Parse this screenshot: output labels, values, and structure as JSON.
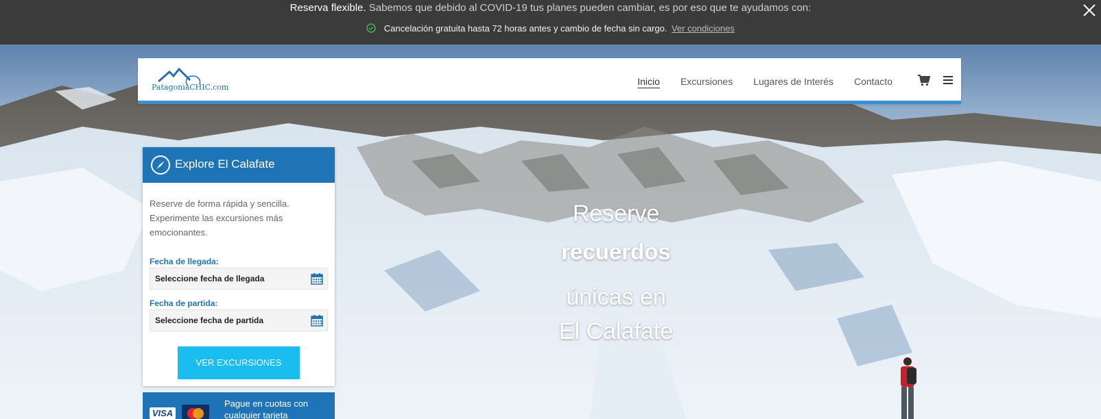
{
  "notice": {
    "headline_strong": "Reserva flexible.",
    "headline_rest": "Sabemos que debido al COVID-19 tus planes pueden cambiar, es por eso que te ayudamos con:",
    "benefit": "Cancelación gratuita hasta 72 horas antes y cambio de fecha sin cargo.",
    "link": "Ver condiciones",
    "icons": {
      "check": "check-circle-icon",
      "close": "close-icon"
    },
    "colors": {
      "background": "#3b3b3b",
      "check": "#3fb54a"
    }
  },
  "header": {
    "logo_text": "PatagoniaCHIC.com",
    "nav": [
      "Inicio",
      "Excursiones",
      "Lugares de Interés",
      "Contacto"
    ],
    "active_nav": "Inicio",
    "icons": {
      "cart": "cart-icon",
      "menu": "hamburger-menu-icon"
    },
    "accent": "#3d8fcf"
  },
  "booking": {
    "title": "Explore El Calafate",
    "description": "Reserve de forma rápida y sencilla. Experimente las excursiones más emocionantes.",
    "arrival_label": "Fecha de llegada:",
    "arrival_placeholder": "Seleccione fecha de llegada",
    "departure_label": "Fecha de partida:",
    "departure_placeholder": "Seleccione fecha de partida",
    "cta": "VER EXCURSIONES",
    "colors": {
      "header": "#1f74b8",
      "cta": "#19bdf0"
    },
    "icons": {
      "title": "compass-icon",
      "date": "calendar-icon"
    }
  },
  "payments": {
    "visa": "VISA",
    "text": "Pague en cuotas con",
    "text_partial": "cualquier tarjeta"
  },
  "hero": {
    "line1": "Reserve",
    "line2": "recuerdos",
    "line3": "únicas en",
    "line4": "El Calafate"
  }
}
